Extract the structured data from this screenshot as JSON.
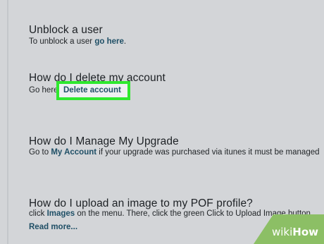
{
  "faq": [
    {
      "title": "Unblock a user",
      "body_prefix": "To unblock a user ",
      "link_text": "go here",
      "body_suffix": "."
    },
    {
      "title": "How do I delete my account",
      "body_prefix": "Go here",
      "link_text": "Delete account",
      "body_suffix": ""
    },
    {
      "title": "How do I Manage My Upgrade",
      "body_prefix": "Go to ",
      "link_text": "My Account",
      "body_suffix": " if your upgrade was purchased via itunes it must be managed"
    },
    {
      "title": "How do I upload an image to my POF profile?",
      "body_prefix": "click ",
      "link_text": "Images",
      "body_suffix": " on the menu. There, click the green Click to Upload Image button",
      "read_more": "Read more..."
    }
  ],
  "watermark": {
    "prefix": "wiki",
    "suffix": "How"
  },
  "colors": {
    "background": "#d3d5d8",
    "link": "#1f4f66",
    "highlight": "#2ee82e",
    "watermark": "#8cbf65"
  }
}
